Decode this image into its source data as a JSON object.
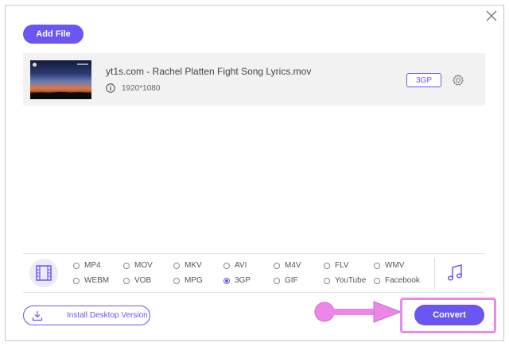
{
  "toolbar": {
    "add_file_label": "Add File"
  },
  "file": {
    "name": "yt1s.com - Rachel Platten Fight Song Lyrics.mov",
    "resolution": "1920*1080",
    "output_format": "3GP"
  },
  "formats": {
    "options": [
      "MP4",
      "MOV",
      "MKV",
      "AVI",
      "M4V",
      "FLV",
      "WMV",
      "WEBM",
      "VOB",
      "MPG",
      "3GP",
      "GIF",
      "YouTube",
      "Facebook"
    ],
    "selected": "3GP"
  },
  "footer": {
    "install_label": "Install Desktop Version",
    "convert_label": "Convert"
  },
  "colors": {
    "accent": "#6a57f2",
    "highlight": "#e88ae6"
  },
  "icons": [
    "close-icon",
    "info-icon",
    "gear-icon",
    "video-format-icon",
    "music-note-icon",
    "download-icon",
    "arrow-icon"
  ]
}
